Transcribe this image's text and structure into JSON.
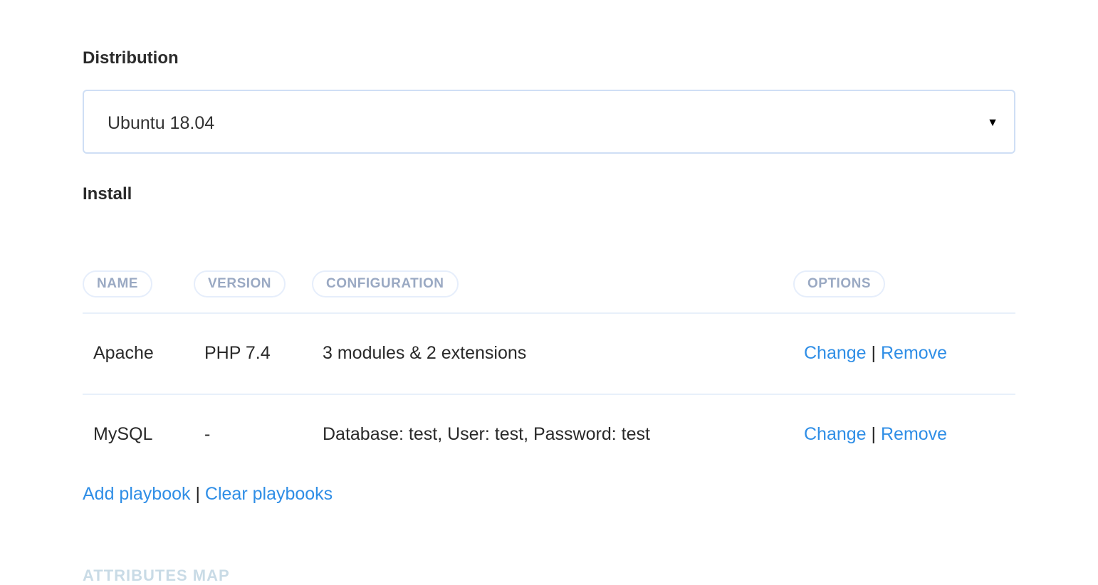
{
  "distribution": {
    "title": "Distribution",
    "selected": "Ubuntu 18.04",
    "arrow_icon": "▼"
  },
  "install": {
    "title": "Install",
    "columns": [
      "NAME",
      "VERSION",
      "CONFIGURATION",
      "OPTIONS"
    ],
    "rows": [
      {
        "name": "Apache",
        "version": "PHP 7.4",
        "configuration": "3 modules & 2 extensions",
        "change": "Change",
        "remove": "Remove"
      },
      {
        "name": "MySQL",
        "version": "-",
        "configuration": "Database: test, User: test, Password: test",
        "change": "Change",
        "remove": "Remove"
      }
    ],
    "separator": "|"
  },
  "footer": {
    "add_label": "Add playbook",
    "clear_label": "Clear playbooks",
    "separator": "|",
    "next_section_partial": "ATTRIBUTES MAP"
  },
  "colors": {
    "link": "#2f8ee6",
    "header_text": "#9aa9c3",
    "border": "#cfdff5"
  }
}
